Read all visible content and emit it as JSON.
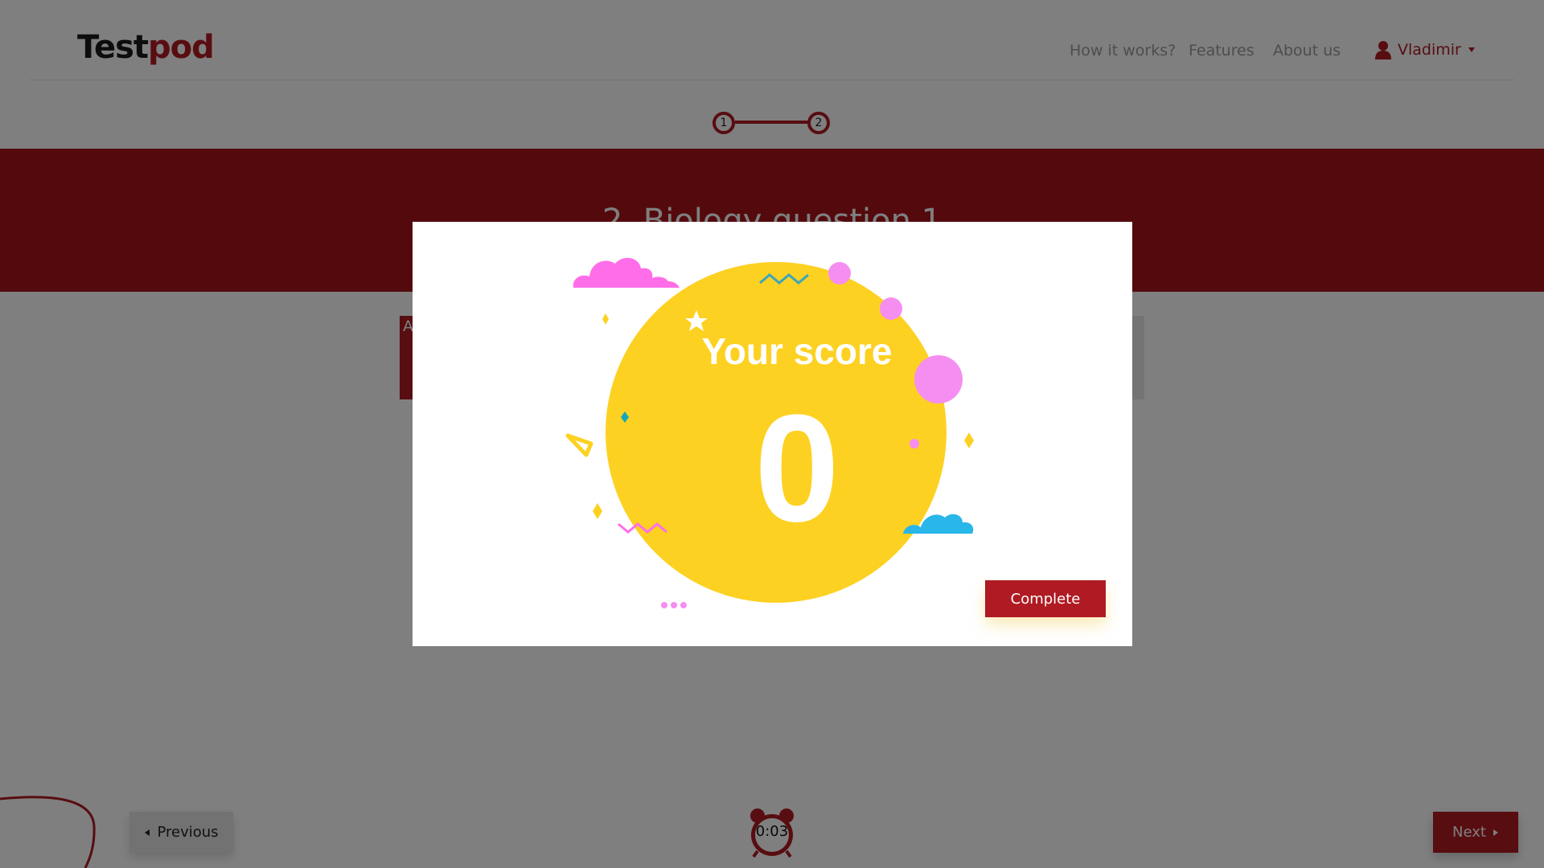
{
  "header": {
    "logo": {
      "part1": "Test",
      "part2": "pod"
    },
    "nav": [
      "How it works?",
      "Features",
      "About us"
    ],
    "user": {
      "name": "Vladimir",
      "icon": "user-icon",
      "caret_icon": "caret-down-icon"
    }
  },
  "stepper": {
    "steps": [
      "1",
      "2"
    ],
    "current": 2
  },
  "question": {
    "title": "2. Biology question 1",
    "answer_prefix": "A"
  },
  "footer": {
    "previous_label": "Previous",
    "next_label": "Next",
    "timer": "0:03",
    "timer_icon": "alarm-clock-icon"
  },
  "modal": {
    "score_label": "Your score",
    "score_value": "0",
    "complete_label": "Complete"
  },
  "colors": {
    "brand_red": "#b01a22",
    "score_circle": "#fdd122",
    "overlay": "rgba(0,0,0,0.5)"
  }
}
